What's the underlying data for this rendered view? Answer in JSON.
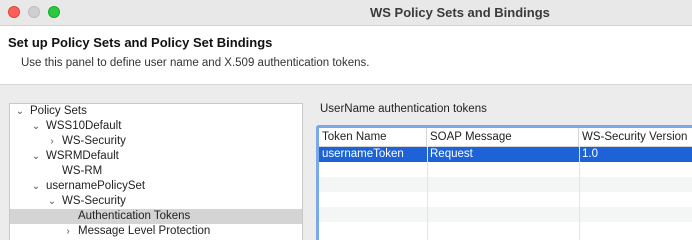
{
  "window": {
    "title": "WS Policy Sets and Bindings"
  },
  "header": {
    "title": "Set up Policy Sets and Policy Set Bindings",
    "description": "Use this panel to define user name and X.509 authentication tokens."
  },
  "tree": {
    "items": [
      {
        "label": "Policy Sets",
        "expanded": true
      },
      {
        "label": "WSS10Default",
        "expanded": true
      },
      {
        "label": "WS-Security",
        "expanded": false
      },
      {
        "label": "WSRMDefault",
        "expanded": true
      },
      {
        "label": "WS-RM"
      },
      {
        "label": "usernamePolicySet",
        "expanded": true
      },
      {
        "label": "WS-Security",
        "expanded": true
      },
      {
        "label": "Authentication Tokens",
        "selected": true
      },
      {
        "label": "Message Level Protection",
        "expanded": false
      }
    ]
  },
  "tokens_panel": {
    "title": "UserName authentication tokens",
    "columns": [
      "Token Name",
      "SOAP Message",
      "WS-Security Version"
    ],
    "rows": [
      {
        "token_name": "usernameToken",
        "soap_message": "Request",
        "ws_security_version": "1.0",
        "selected": true
      }
    ]
  },
  "colors": {
    "selection": "#1d62d6",
    "focus_ring": "#7aa8e8",
    "tree_selection": "#d4d4d4"
  }
}
